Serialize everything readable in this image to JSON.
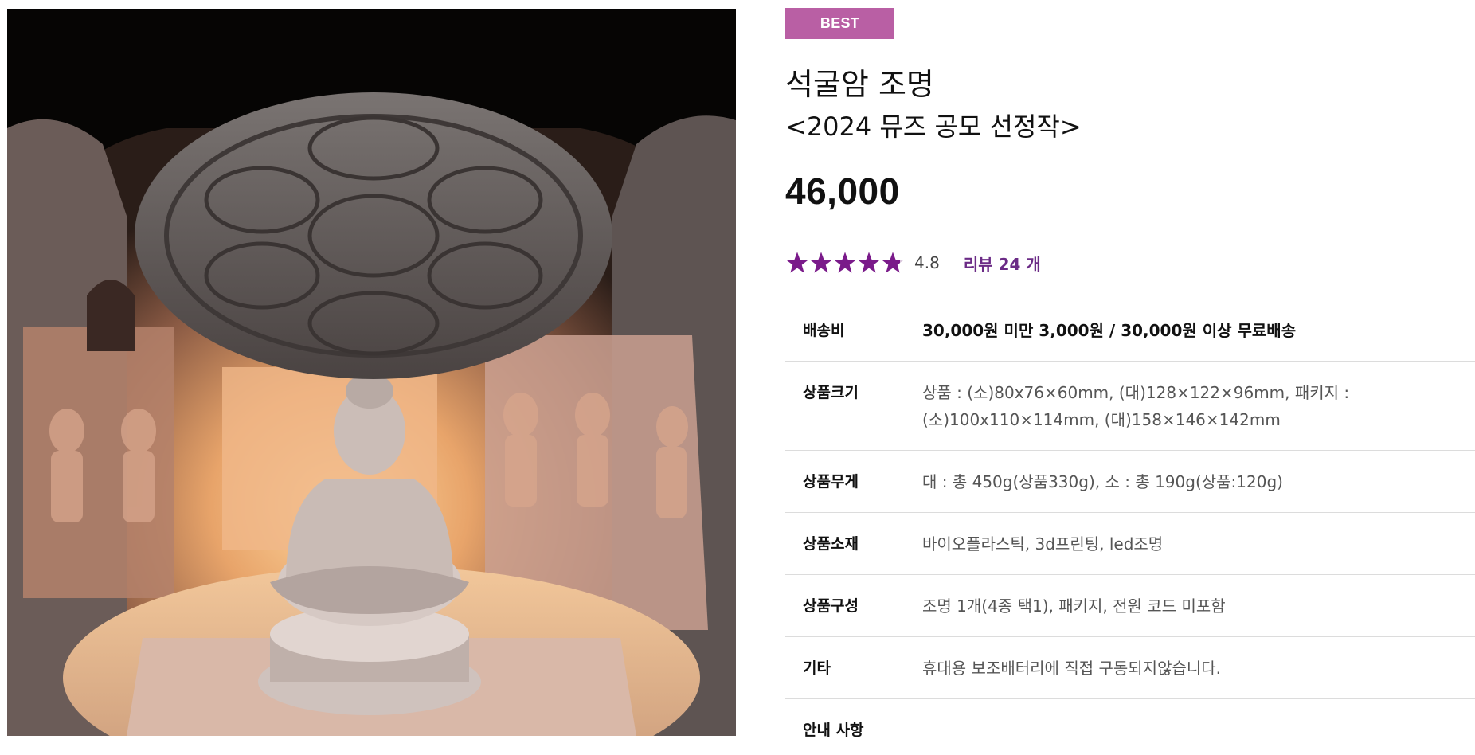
{
  "product": {
    "badge": "BEST",
    "title": "석굴암 조명",
    "subtitle": "<2024 뮤즈 공모 선정작>",
    "price": "46,000",
    "rating": {
      "score": 4.8,
      "score_text": "4.8",
      "stars_max": 5,
      "review_link": "리뷰 24 개",
      "star_color": "#7a1a8a"
    },
    "specs": [
      {
        "label": "배송비",
        "value": "30,000원 미만 3,000원 / 30,000원 이상 무료배송"
      },
      {
        "label": "상품크기",
        "value": "상품 : (소)80x76×60mm, (대)128×122×96mm, 패키지 :",
        "value2": "(소)100x110×114mm, (대)158×146×142mm"
      },
      {
        "label": "상품무게",
        "value": "대 : 총 450g(상품330g), 소 : 총 190g(상품:120g)"
      },
      {
        "label": "상품소재",
        "value": "바이오플라스틱, 3d프린팅, led조명"
      },
      {
        "label": "상품구성",
        "value": "조명 1개(4종 택1), 패키지, 전원 코드 미포함"
      },
      {
        "label": "기타",
        "value": "휴대용 보조배터리에 직접 구동되지않습니다."
      },
      {
        "label": "안내 사항",
        "value": ""
      }
    ]
  },
  "colors": {
    "badge_bg": "#b95fa4",
    "review_link": "#6b2b86",
    "divider": "#dcdcdc"
  }
}
